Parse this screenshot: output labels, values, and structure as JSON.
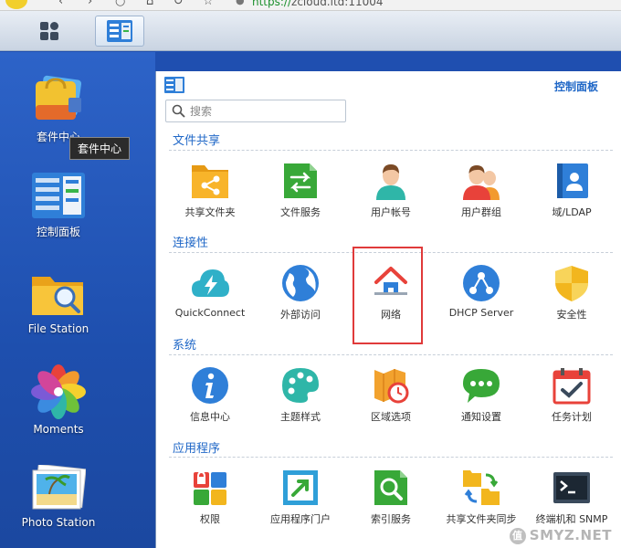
{
  "browser": {
    "url_prefix": "https://",
    "url_rest": "zcloud.ltd:11004"
  },
  "desktop": {
    "icons": [
      {
        "label": "套件中心"
      },
      {
        "label": "控制面板"
      },
      {
        "label": "File Station"
      },
      {
        "label": "Moments"
      },
      {
        "label": "Photo Station"
      }
    ],
    "tooltip": "套件中心"
  },
  "window": {
    "title": "控制面板",
    "search": {
      "placeholder": "搜索"
    },
    "sections": [
      {
        "title": "文件共享",
        "items": [
          "共享文件夹",
          "文件服务",
          "用户帐号",
          "用户群组",
          "域/LDAP"
        ]
      },
      {
        "title": "连接性",
        "items": [
          "QuickConnect",
          "外部访问",
          "网络",
          "DHCP Server",
          "安全性"
        ]
      },
      {
        "title": "系统",
        "items": [
          "信息中心",
          "主题样式",
          "区域选项",
          "通知设置",
          "任务计划"
        ]
      },
      {
        "title": "应用程序",
        "items": [
          "权限",
          "应用程序门户",
          "索引服务",
          "共享文件夹同步",
          "终端机和 SNMP"
        ]
      }
    ]
  },
  "watermark": {
    "badge": "值",
    "text": "SMYZ.NET"
  },
  "colors": {
    "accent": "#1f67c7",
    "highlight": "#e03a3a",
    "desktop": "#2358bd"
  }
}
